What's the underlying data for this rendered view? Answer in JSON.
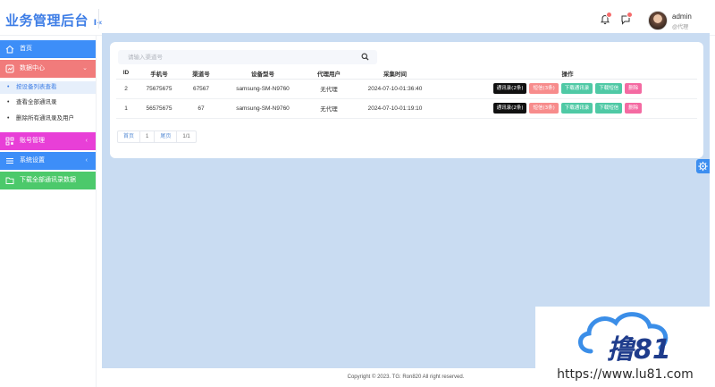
{
  "app": {
    "title": "业务管理后台",
    "title_suffix": "I«"
  },
  "header": {
    "user_name": "admin",
    "user_role": "@代理"
  },
  "sidebar": {
    "items": [
      {
        "label": "首页",
        "color": "#3d8ef8"
      },
      {
        "label": "数据中心",
        "color": "#f17b7b",
        "arrow": "⌄"
      },
      {
        "label": "账号管理",
        "color": "#e83fd7",
        "arrow": "‹"
      },
      {
        "label": "系统设置",
        "color": "#3d8ef8",
        "arrow": "‹"
      },
      {
        "label": "下载全部通讯录数据",
        "color": "#4cc96b"
      }
    ],
    "sub_items": [
      {
        "label": "按设备列表查看"
      },
      {
        "label": "查看全部通讯录"
      },
      {
        "label": "删除所有通讯录及用户"
      }
    ]
  },
  "search": {
    "placeholder": "请输入渠道号"
  },
  "table": {
    "headers": [
      "ID",
      "手机号",
      "渠道号",
      "设备型号",
      "代理用户",
      "采集时间",
      "操作"
    ],
    "rows": [
      {
        "id": "2",
        "phone": "75675675",
        "channel": "67567",
        "device": "samsung-SM-N9760",
        "agent": "无代理",
        "time": "2024-07-10-01:36:40"
      },
      {
        "id": "1",
        "phone": "56575675",
        "channel": "67",
        "device": "samsung-SM-N9760",
        "agent": "无代理",
        "time": "2024-07-10-01:19:10"
      }
    ],
    "actions": {
      "contacts": "通讯录(2条)",
      "sms": "短信(3条)",
      "download_contacts": "下载通讯录",
      "download_sms": "下载短信",
      "delete": "删除"
    }
  },
  "pagination": {
    "first": "首页",
    "current": "1",
    "last": "尾页",
    "summary": "1/1"
  },
  "footer": {
    "copyright": "Copyright © 2023. TG:  Ron820 All right reserved."
  },
  "watermark": {
    "brand": "撸81",
    "url": "https://www.lu81.com"
  },
  "colors": {
    "accent": "#3d7de6",
    "main_bg": "#c9dcf2",
    "btn_black": "#111111",
    "btn_pink": "#f78c8c",
    "btn_green": "#4fc9a5",
    "btn_magenta": "#f46aa2"
  },
  "icons": {
    "bell": "bell-icon",
    "chat": "chat-icon",
    "home": "home-icon",
    "data": "data-icon",
    "account": "qr-icon",
    "settings": "list-icon",
    "download": "folder-icon",
    "search": "search-icon",
    "gear": "gear-icon"
  }
}
